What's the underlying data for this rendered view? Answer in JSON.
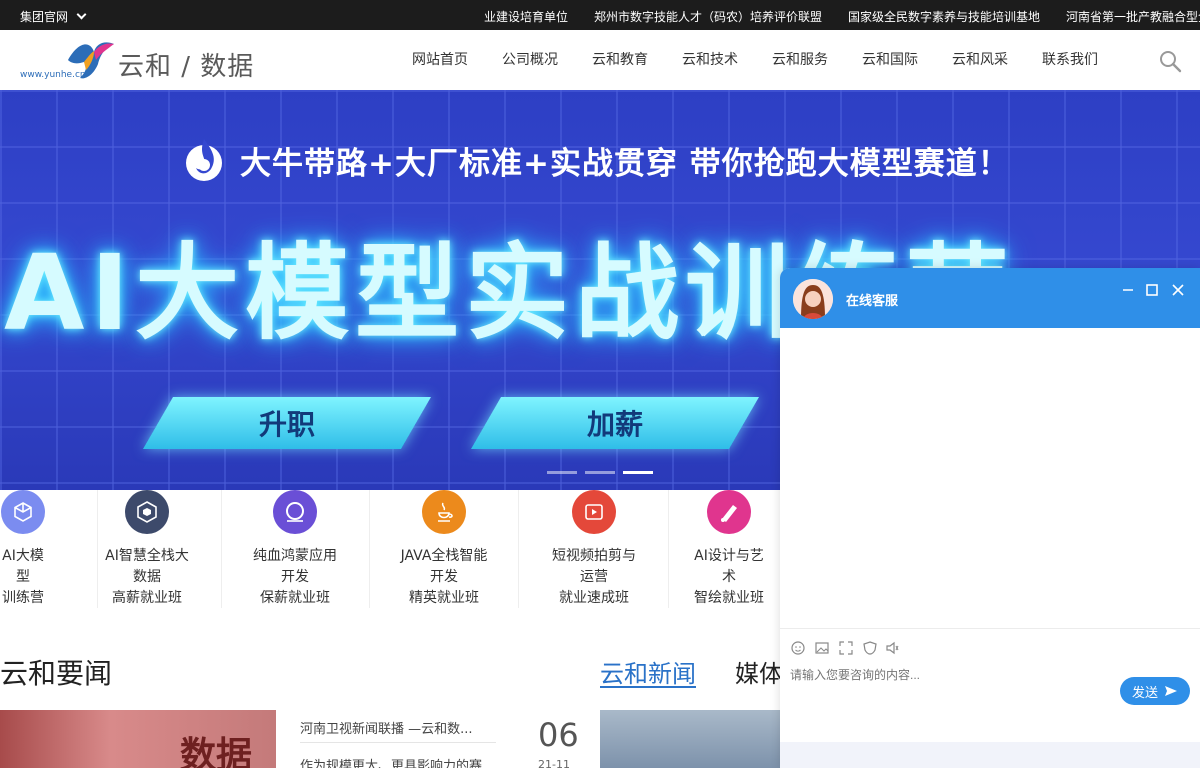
{
  "topbar": {
    "group_label": "集团官网",
    "links": [
      "业建设培育单位",
      "郑州市数字技能人才（码农）培养评价联盟",
      "国家级全民数字素养与技能培训基地",
      "河南省第一批产教融合型企"
    ]
  },
  "header": {
    "logo_url": "www.yunhe.cn",
    "logo_name": "云和 / 数据",
    "nav": [
      "网站首页",
      "公司概况",
      "云和教育",
      "云和技术",
      "云和服务",
      "云和国际",
      "云和风采",
      "联系我们"
    ]
  },
  "banner": {
    "slogan": "大牛带路+大厂标准+实战贯穿  带你抢跑大模型赛道！",
    "headline": "AI大模型实战训练营",
    "tag1": "升职",
    "tag2": "加薪",
    "active_slide": 3,
    "slide_count": 3
  },
  "courses": [
    {
      "title": "AI大模\n型\n训练营",
      "icon": "cube-icon",
      "color": "#7b8cf0"
    },
    {
      "title": "AI智慧全栈大\n数据\n高薪就业班",
      "icon": "hexagon-icon",
      "color": "#3d4a6b"
    },
    {
      "title": "纯血鸿蒙应用\n开发\n保薪就业班",
      "icon": "ring-icon",
      "color": "#6a4fd6"
    },
    {
      "title": "JAVA全栈智能\n开发\n精英就业班",
      "icon": "java-icon",
      "color": "#ec8a1c"
    },
    {
      "title": "短视频拍剪与\n运营\n就业速成班",
      "icon": "video-icon",
      "color": "#e4483a"
    },
    {
      "title": "AI设计与艺\n术\n智绘就业班",
      "icon": "brush-icon",
      "color": "#e0358e"
    }
  ],
  "news": {
    "section_title": "云和要闻",
    "tab_active": "云和新闻",
    "tab_other": "媒体",
    "items": [
      "河南卫视新闻联播 —云和数...",
      "作为规模更大、更具影响力的赛"
    ],
    "day": "06",
    "date": "21-11",
    "img_text": "数据"
  },
  "chat": {
    "title": "在线客服",
    "input_placeholder": "请输入您要咨询的内容...",
    "send_label": "发送"
  },
  "colors": {
    "topbar": "#1c1c1c",
    "banner": "#3548d0",
    "accent": "#2a72c8",
    "chat_header": "#2f8fe8"
  }
}
